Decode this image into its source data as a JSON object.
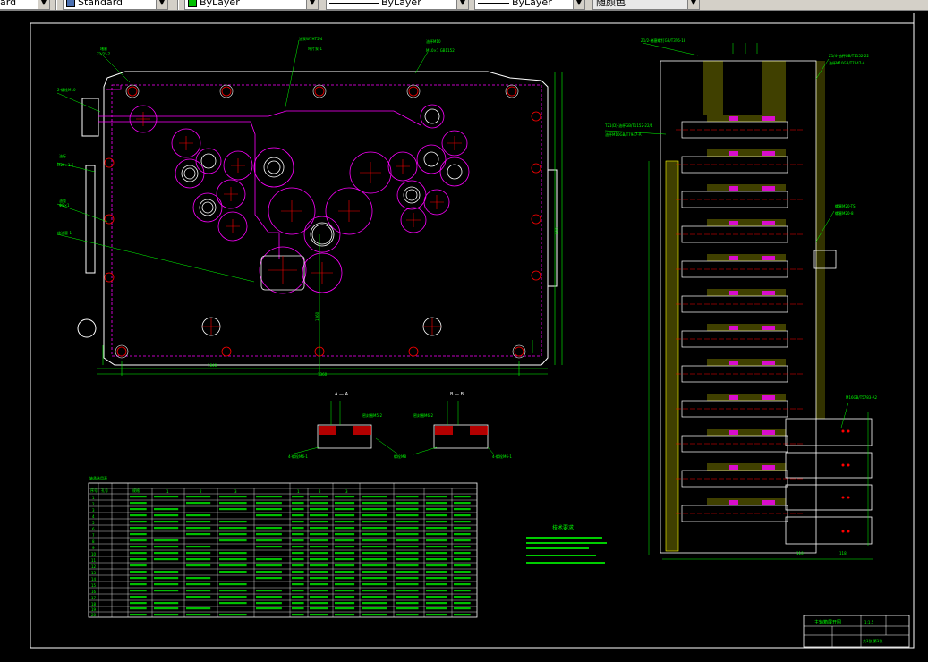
{
  "toolbar": {
    "combo_text_style": "ard",
    "combo_dim_style": "Standard",
    "combo_layer_color": "ByLayer",
    "combo_linetype": "ByLayer",
    "combo_lineweight": "ByLayer",
    "combo_plot_color": "随颜色"
  },
  "colors": {
    "background": "#000000",
    "frame": "#ffffff",
    "dimension": "#00ff00",
    "hidden_lines": "#ff00ff",
    "centerlines": "#ff0000",
    "outline": "#ffffff"
  },
  "drawing": {
    "section_a_label": "A — A",
    "section_b_label": "B — B",
    "tech_req_title": "技术要求"
  },
  "table": {
    "header": [
      "序号",
      "孔号",
      "规格",
      "1",
      "2",
      "3",
      "1",
      "2",
      "3"
    ],
    "rows": [
      "1",
      "2",
      "3",
      "4",
      "5",
      "6",
      "7",
      "8",
      "9",
      "10",
      "11",
      "12",
      "13",
      "14",
      "15",
      "16",
      "17",
      "18",
      "19",
      "20"
    ]
  },
  "title_block": {
    "title": "主轴箱展开图",
    "scale": "1:1.5",
    "sheet": "共1张 第1张"
  }
}
